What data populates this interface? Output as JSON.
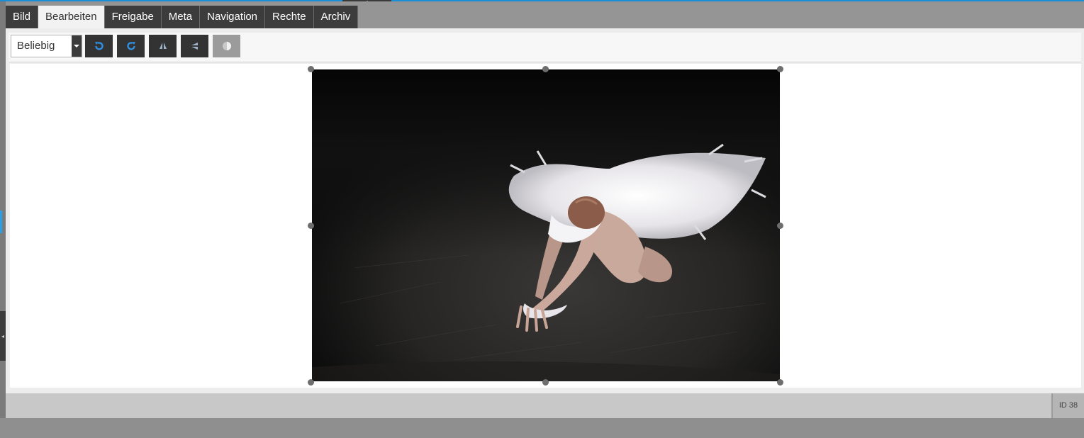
{
  "tabs": [
    {
      "label": "Bild",
      "active": false
    },
    {
      "label": "Bearbeiten",
      "active": true
    },
    {
      "label": "Freigabe",
      "active": false
    },
    {
      "label": "Meta",
      "active": false
    },
    {
      "label": "Navigation",
      "active": false
    },
    {
      "label": "Rechte",
      "active": false
    },
    {
      "label": "Archiv",
      "active": false
    }
  ],
  "toolbar": {
    "aspect_select": {
      "value": "Beliebig"
    },
    "buttons": [
      {
        "name": "rotate-left",
        "icon": "rotate-left-icon"
      },
      {
        "name": "rotate-right",
        "icon": "rotate-right-icon"
      },
      {
        "name": "flip-horizontal",
        "icon": "flip-horizontal-icon"
      },
      {
        "name": "flip-vertical",
        "icon": "flip-vertical-icon"
      },
      {
        "name": "grayscale",
        "icon": "contrast-icon",
        "disabled": true
      }
    ]
  },
  "image": {
    "subject": "ballerina-photo"
  },
  "status": {
    "id_label": "ID 38"
  },
  "colors": {
    "accent": "#1a8fd6",
    "icon_blue": "#2f8fe0",
    "tab_dark": "#3c3c3c",
    "tab_active": "#f2f2f2"
  }
}
